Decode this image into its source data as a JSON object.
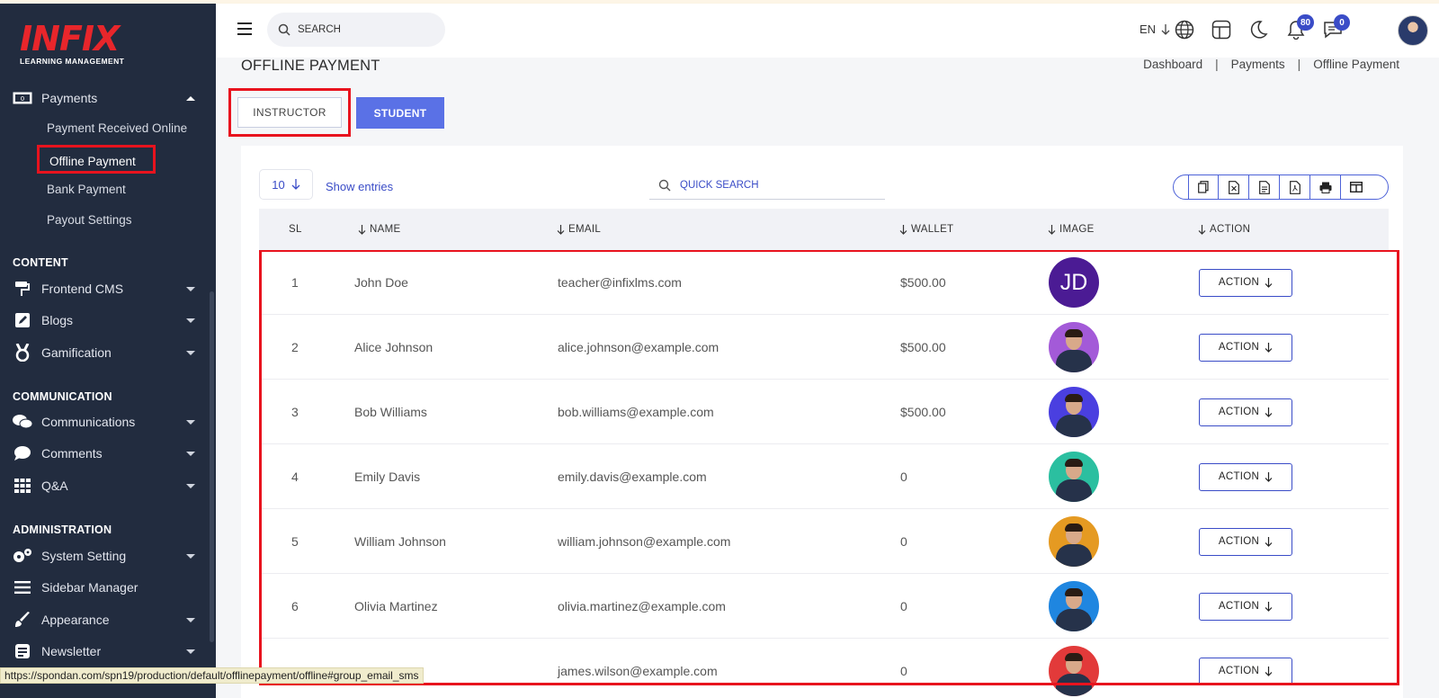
{
  "brand": {
    "name": "INFIX",
    "tagline": "LEARNING MANAGEMENT"
  },
  "sidebar": {
    "payments": {
      "label": "Payments",
      "icon": "money-icon"
    },
    "payment_subitems": [
      {
        "label": "Payment Received Online"
      },
      {
        "label": "Offline Payment",
        "active": true
      },
      {
        "label": "Bank Payment"
      },
      {
        "label": "Payout Settings"
      }
    ],
    "sections": [
      {
        "heading": "CONTENT",
        "items": [
          {
            "label": "Frontend CMS",
            "icon": "paint-roller-icon"
          },
          {
            "label": "Blogs",
            "icon": "edit-icon"
          },
          {
            "label": "Gamification",
            "icon": "medal-icon"
          }
        ]
      },
      {
        "heading": "COMMUNICATION",
        "items": [
          {
            "label": "Communications",
            "icon": "chat-bubbles-icon"
          },
          {
            "label": "Comments",
            "icon": "comment-icon"
          },
          {
            "label": "Q&A",
            "icon": "grid-icon"
          }
        ]
      },
      {
        "heading": "ADMINISTRATION",
        "items": [
          {
            "label": "System Setting",
            "icon": "gears-icon"
          },
          {
            "label": "Sidebar Manager",
            "icon": "menu-lines-icon"
          },
          {
            "label": "Appearance",
            "icon": "brush-icon"
          },
          {
            "label": "Newsletter",
            "icon": "newsletter-icon"
          }
        ]
      }
    ]
  },
  "header": {
    "search_placeholder": "SEARCH",
    "language": "EN",
    "notifications_count": "80",
    "messages_count": "0"
  },
  "page": {
    "title": "OFFLINE PAYMENT",
    "breadcrumb": [
      "Dashboard",
      "Payments",
      "Offline Payment"
    ],
    "tabs": {
      "instructor": "INSTRUCTOR",
      "student": "STUDENT"
    }
  },
  "table": {
    "entries_value": "10",
    "show_entries_label": "Show entries",
    "quick_search_placeholder": "QUICK SEARCH",
    "columns": [
      "SL",
      "NAME",
      "EMAIL",
      "WALLET",
      "IMAGE",
      "ACTION"
    ],
    "action_label": "ACTION",
    "rows": [
      {
        "sl": "1",
        "name": "John Doe",
        "email": "teacher@infixlms.com",
        "wallet": "$500.00",
        "image": "JD"
      },
      {
        "sl": "2",
        "name": "Alice Johnson",
        "email": "alice.johnson@example.com",
        "wallet": "$500.00",
        "image": "photo"
      },
      {
        "sl": "3",
        "name": "Bob Williams",
        "email": "bob.williams@example.com",
        "wallet": "$500.00",
        "image": "photo"
      },
      {
        "sl": "4",
        "name": "Emily Davis",
        "email": "emily.davis@example.com",
        "wallet": "0",
        "image": "photo"
      },
      {
        "sl": "5",
        "name": "William Johnson",
        "email": "william.johnson@example.com",
        "wallet": "0",
        "image": "photo"
      },
      {
        "sl": "6",
        "name": "Olivia Martinez",
        "email": "olivia.martinez@example.com",
        "wallet": "0",
        "image": "photo"
      },
      {
        "sl": "",
        "name": "",
        "email": "james.wilson@example.com",
        "wallet": "0",
        "image": "photo"
      }
    ],
    "avatar_colors": [
      "#4b1b94",
      "#a35ad8",
      "#4a3fe0",
      "#2bbfa0",
      "#e59a22",
      "#1f86e0",
      "#e23a3a"
    ]
  },
  "status_bar": "https://spondan.com/spn19/production/default/offlinepayment/offline#group_email_sms"
}
